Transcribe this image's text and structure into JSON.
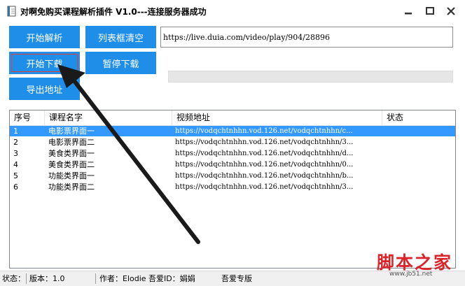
{
  "window": {
    "title": "对啊免购买课程解析插件 V1.0---连接服务器成功",
    "icons": {
      "app": "book-icon",
      "minimize": "minimize-icon",
      "maximize": "maximize-icon",
      "close": "close-icon"
    }
  },
  "toolbar": {
    "parse_label": "开始解析",
    "clear_label": "列表框清空",
    "download_label": "开始下载",
    "pause_label": "暂停下载",
    "export_label": "导出地址"
  },
  "url_input": {
    "value": "https://live.duia.com/video/play/904/28896"
  },
  "progress": {
    "value": 0
  },
  "list": {
    "columns": [
      "序号",
      "课程名字",
      "视频地址",
      "状态"
    ],
    "rows": [
      {
        "no": "1",
        "name": "电影票界面一",
        "url": "https://vodqchtnhhn.vod.126.net/vodqchtnhhn/c...",
        "status": ""
      },
      {
        "no": "2",
        "name": "电影票界面二",
        "url": "https://vodqchtnhhn.vod.126.net/vodqchtnhhn/3...",
        "status": ""
      },
      {
        "no": "3",
        "name": "美食类界面一",
        "url": "https://vodqchtnhhn.vod.126.net/vodqchtnhhn/d...",
        "status": ""
      },
      {
        "no": "4",
        "name": "美食类界面二",
        "url": "https://vodqchtnhhn.vod.126.net/vodqchtnhhn/0...",
        "status": ""
      },
      {
        "no": "5",
        "name": "功能类界面一",
        "url": "https://vodqchtnhhn.vod.126.net/vodqchtnhhn/b...",
        "status": ""
      },
      {
        "no": "6",
        "name": "功能类界面二",
        "url": "https://vodqchtnhhn.vod.126.net/vodqchtnhhn/3...",
        "status": ""
      }
    ],
    "selected_index": 0
  },
  "statusbar": {
    "status_label": "状态：",
    "version": "版本：1.0",
    "author": "作者：Elodie 吾爱ID：娟娟",
    "edition": "吾爱专版"
  },
  "watermark": {
    "main": "脚本之家",
    "sub": "www.jb51.net"
  },
  "colors": {
    "button": "#1f8ee8",
    "selection": "#3399ff",
    "arrow": "#1a1a1a",
    "watermark": "#d8242a",
    "focus": "#e0413a"
  }
}
